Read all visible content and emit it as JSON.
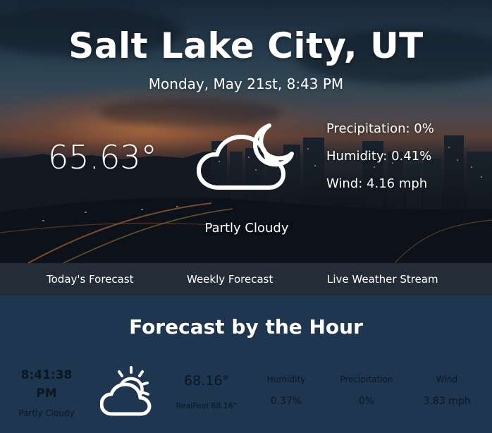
{
  "header": {
    "city": "Salt Lake City, UT",
    "datetime": "Monday, May 21st, 8:43 PM"
  },
  "current": {
    "temperature": "65.63°",
    "condition": "Partly Cloudy",
    "condition_icon": "partly-cloudy-night-icon",
    "precipitation": "Precipitation: 0%",
    "humidity": "Humidity: 0.41%",
    "wind": "Wind: 4.16 mph"
  },
  "nav": {
    "items": [
      "Today's Forecast",
      "Weekly Forecast",
      "Live Weather Stream"
    ]
  },
  "hourly": {
    "title": "Forecast by the Hour",
    "time_line1": "8:41:38",
    "time_line2": "PM",
    "condition": "Partly Cloudy",
    "condition_icon": "partly-cloudy-day-icon",
    "temperature": "68.16°",
    "realfeel": "RealFeel 68.16°",
    "humidity_label": "Humidity",
    "humidity_value": "0.37%",
    "precipitation_label": "Precipitation",
    "precipitation_value": "0%",
    "wind_label": "Wind",
    "wind_value": "3.83 mph"
  },
  "colors": {
    "nav_bg": "#242c37",
    "hourly_bg": "#1f3651",
    "hourly_text": "#0c1622",
    "hero_text": "#ffffff"
  }
}
